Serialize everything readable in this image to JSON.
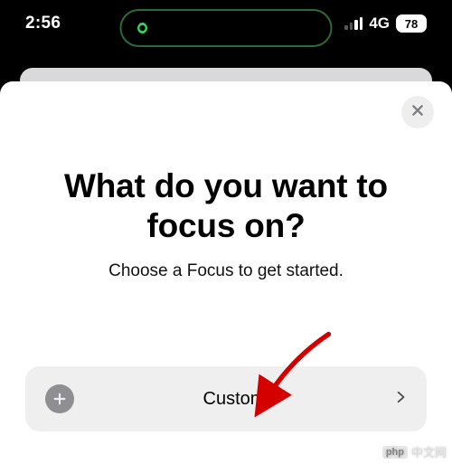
{
  "status": {
    "time": "2:56",
    "network_label": "4G",
    "battery_percent": "78",
    "island_icon": "link-app-icon"
  },
  "sheet": {
    "heading": "What do you want to focus on?",
    "subheading": "Choose a Focus to get started."
  },
  "option": {
    "label": "Custom"
  },
  "watermark": {
    "logo": "php",
    "text": "中文网"
  },
  "annotation": {
    "arrow_color": "#d40000"
  }
}
